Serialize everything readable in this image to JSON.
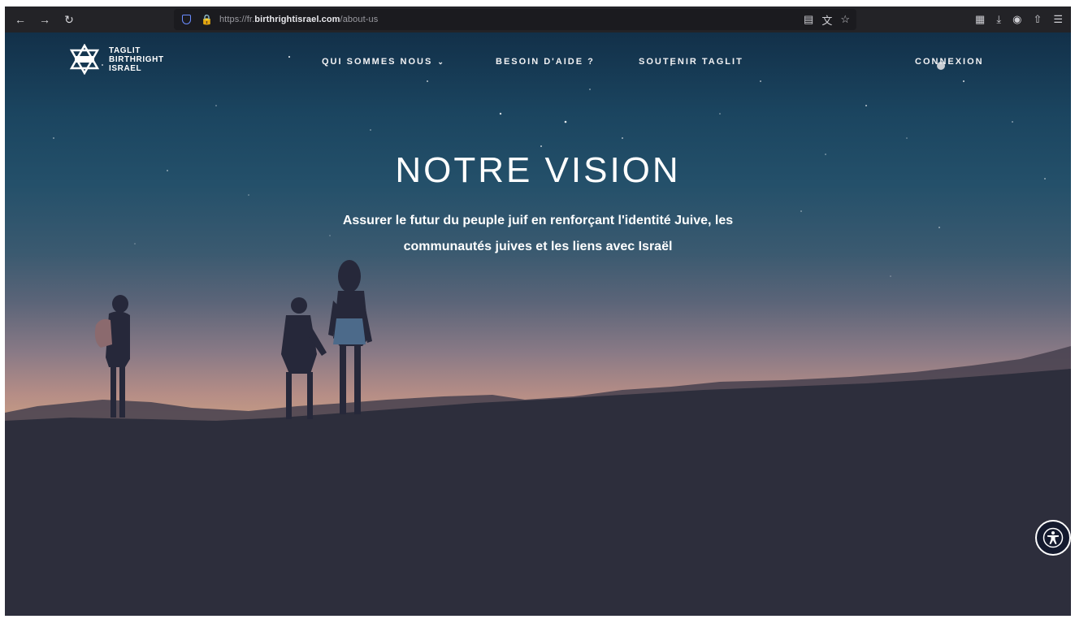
{
  "browser": {
    "url_prefix": "https://fr.",
    "url_domain": "birthrightisrael.com",
    "url_path": "/about-us",
    "icons": {
      "back": "back-arrow-icon",
      "forward": "forward-arrow-icon",
      "reload": "reload-icon",
      "shield": "tracking-shield-icon",
      "lock": "lock-icon",
      "reader": "reader-view-icon",
      "translate": "translate-icon",
      "bookmark": "star-icon",
      "extensions": "extensions-icon",
      "downloads": "download-icon",
      "account": "account-icon",
      "share": "share-icon",
      "menu": "hamburger-menu-icon"
    }
  },
  "site": {
    "logo_lines": [
      "TAGLIT",
      "BIRTHRIGHT",
      "ISRAEL"
    ],
    "nav": {
      "about": "QUI SOMMES NOUS",
      "help": "BESOIN D'AIDE ?",
      "support": "SOUTENIR TAGLIT",
      "login": "CONNEXION"
    }
  },
  "hero": {
    "title": "NOTRE VISION",
    "subtitle_line1": "Assurer le futur du peuple juif en renforçant l'identité Juive, les",
    "subtitle_line2": "communautés juives et les liens avec Israël"
  },
  "accessibility": {
    "icon": "accessibility-icon"
  },
  "colors": {
    "sky_top": "#123049",
    "horizon": "#c49a84",
    "ground": "#2b2c3a",
    "chrome": "#232327"
  }
}
